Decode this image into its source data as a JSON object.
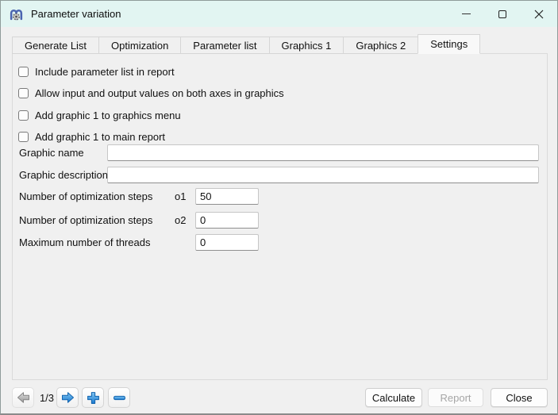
{
  "window": {
    "title": "Parameter variation",
    "controls": [
      "minimize",
      "maximize",
      "close"
    ]
  },
  "tabs": [
    {
      "label": "Generate List",
      "active": false
    },
    {
      "label": "Optimization",
      "active": false
    },
    {
      "label": "Parameter list",
      "active": false
    },
    {
      "label": "Graphics 1",
      "active": false
    },
    {
      "label": "Graphics 2",
      "active": false
    },
    {
      "label": "Settings",
      "active": true
    }
  ],
  "settings_tab": {
    "checkboxes": [
      {
        "label": "Include parameter list in report",
        "checked": false
      },
      {
        "label": "Allow input and output values on both axes in graphics",
        "checked": false
      },
      {
        "label": "Add graphic 1 to graphics menu",
        "checked": false
      },
      {
        "label": "Add graphic 1 to main report",
        "checked": false
      }
    ],
    "text_fields": [
      {
        "label": "Graphic name",
        "value": ""
      },
      {
        "label": "Graphic description",
        "value": ""
      }
    ],
    "number_fields": [
      {
        "label": "Number of optimization steps",
        "symbol": "o1",
        "value": "50"
      },
      {
        "label": "Number of optimization steps",
        "symbol": "o2",
        "value": "0"
      },
      {
        "label": "Maximum number of threads",
        "symbol": "",
        "value": "0"
      }
    ]
  },
  "footer": {
    "page_indicator": "1/3",
    "prev_enabled": false,
    "buttons": [
      {
        "label": "Calculate",
        "enabled": true
      },
      {
        "label": "Report",
        "enabled": false
      },
      {
        "label": "Close",
        "enabled": true
      }
    ]
  },
  "colors": {
    "titlebar_bg": "#e2f5f2",
    "dialog_bg": "#f0f0f0",
    "accent_blue": "#1a7ad0",
    "disabled_gray": "#9f9f9f"
  }
}
